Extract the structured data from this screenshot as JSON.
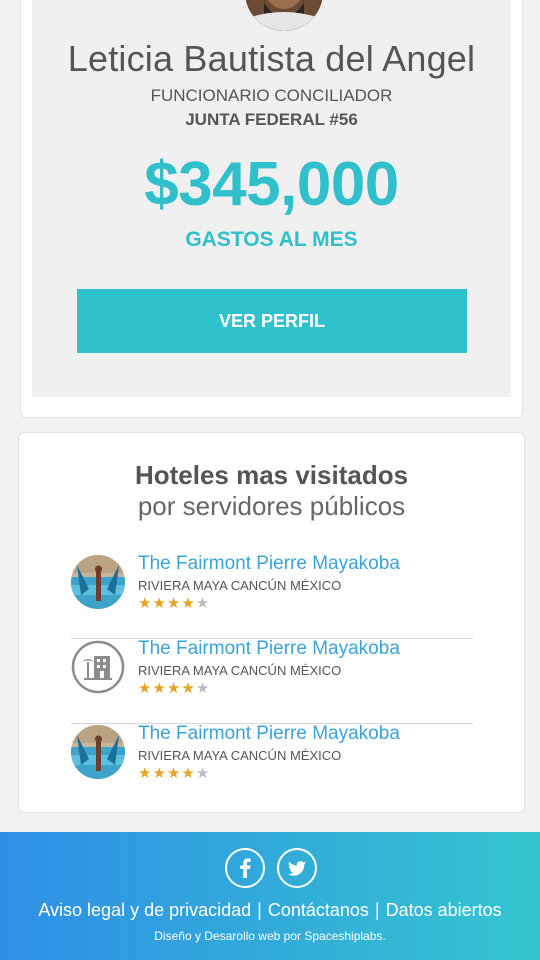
{
  "profile": {
    "name": "Leticia Bautista del Angel",
    "role": "FUNCIONARIO CONCILIADOR",
    "office": "JUNTA FEDERAL #56",
    "amount": "$345,000",
    "amount_label": "GASTOS AL MES",
    "button_label": "VER PERFIL"
  },
  "hotels": {
    "title": "Hoteles mas visitados",
    "subtitle": "por servidores públicos",
    "items": [
      {
        "name": "The Fairmont Pierre Mayakoba",
        "location": "RIVIERA MAYA CANCÚN MÉXICO",
        "rating": 4,
        "max_rating": 5,
        "thumb": "resort-photo"
      },
      {
        "name": "The Fairmont Pierre Mayakoba",
        "location": "RIVIERA MAYA CANCÚN MÉXICO",
        "rating": 4,
        "max_rating": 5,
        "thumb": "hotel-placeholder-icon"
      },
      {
        "name": "The Fairmont Pierre Mayakoba",
        "location": "RIVIERA MAYA CANCÚN MÉXICO",
        "rating": 4,
        "max_rating": 5,
        "thumb": "resort-photo"
      }
    ]
  },
  "footer": {
    "social": [
      {
        "name": "facebook-icon",
        "glyph": "f"
      },
      {
        "name": "twitter-icon",
        "glyph": "t"
      }
    ],
    "links": [
      "Aviso legal y de privacidad",
      "Contáctanos",
      "Datos abiertos"
    ],
    "link_separator": "|",
    "credit": "Diseño y Desarollo web por Spaceshiplabs."
  },
  "colors": {
    "accent": "#2fc2cd",
    "link": "#3ba3dc",
    "star": "#e8a321",
    "star_off": "#bdbdbd",
    "footer_start": "#2f8fe6",
    "footer_end": "#34c6cf"
  }
}
